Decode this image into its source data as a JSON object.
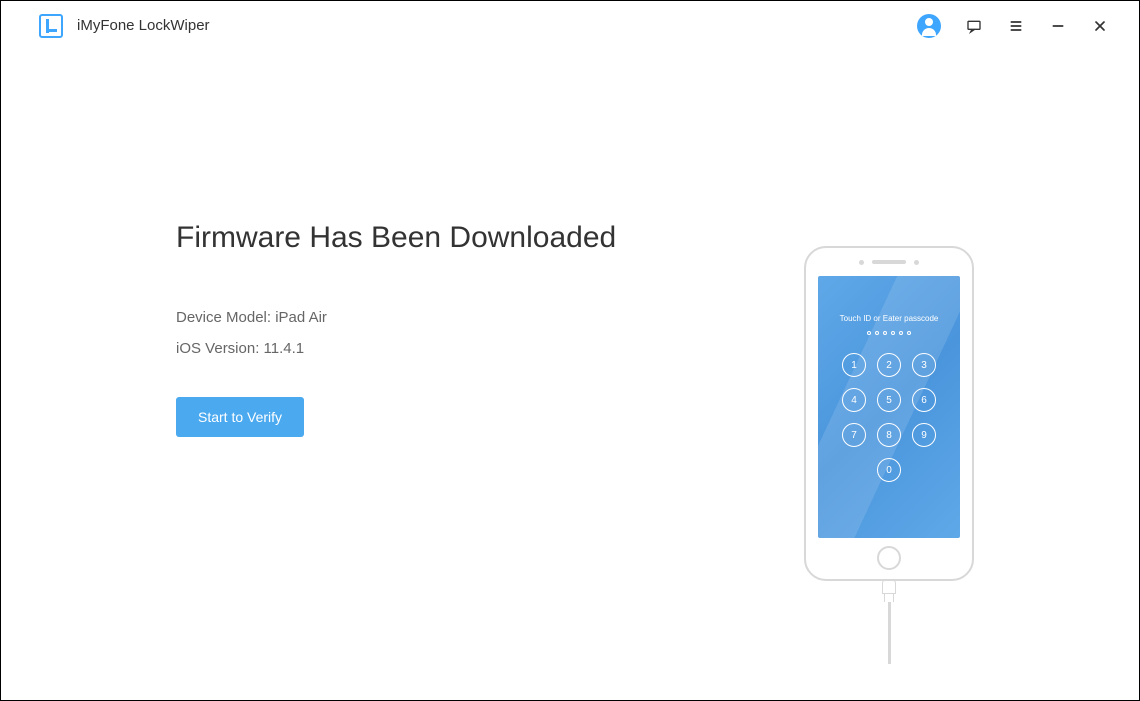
{
  "app": {
    "title": "iMyFone LockWiper"
  },
  "main": {
    "heading": "Firmware Has Been Downloaded",
    "device_model_label": "Device Model:",
    "device_model_value": "iPad Air",
    "ios_version_label": "iOS Version:",
    "ios_version_value": "11.4.1",
    "verify_button": "Start to Verify"
  },
  "phone": {
    "touch_text": "Touch ID or Eater passcode",
    "keys": [
      "1",
      "2",
      "3",
      "4",
      "5",
      "6",
      "7",
      "8",
      "9",
      "0"
    ]
  }
}
